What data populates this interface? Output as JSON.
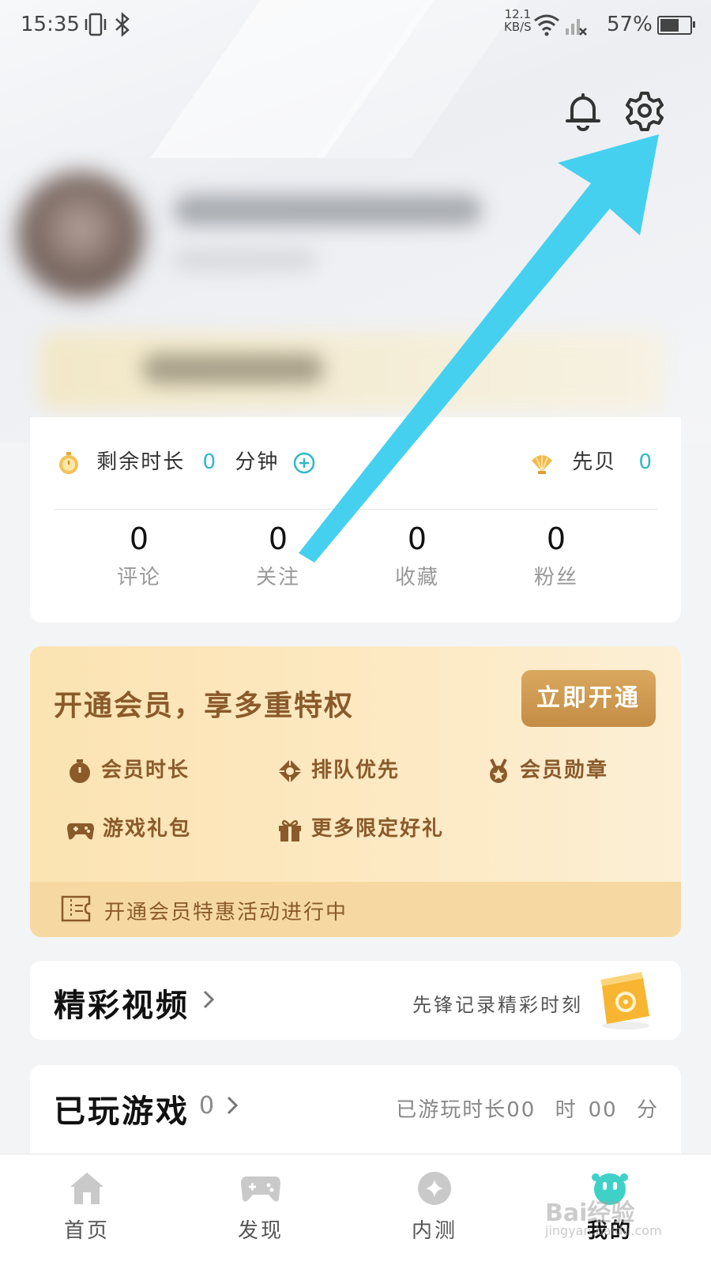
{
  "status_bar": {
    "time": "15:35",
    "speed_value": "12.1",
    "speed_unit": "KB/S",
    "battery": "57%"
  },
  "stats": {
    "remaining_label": "剩余时长",
    "remaining_value": "0",
    "remaining_unit": "分钟",
    "shell_label": "先贝",
    "shell_value": "0",
    "items": [
      {
        "value": "0",
        "label": "评论"
      },
      {
        "value": "0",
        "label": "关注"
      },
      {
        "value": "0",
        "label": "收藏"
      },
      {
        "value": "0",
        "label": "粉丝"
      }
    ]
  },
  "vip": {
    "title": "开通会员，享多重特权",
    "button": "立即开通",
    "perks": [
      {
        "icon": "stopwatch-icon",
        "label": "会员时长"
      },
      {
        "icon": "priority-diamond-icon",
        "label": "排队优先"
      },
      {
        "icon": "medal-icon",
        "label": "会员勋章"
      },
      {
        "icon": "gamepad-icon",
        "label": "游戏礼包"
      },
      {
        "icon": "gift-icon",
        "label": "更多限定好礼"
      }
    ],
    "footer": "开通会员特惠活动进行中"
  },
  "videos": {
    "title": "精彩视频",
    "subtitle": "先锋记录精彩时刻"
  },
  "played": {
    "title": "已玩游戏",
    "count": "0",
    "time_label": "已游玩时长",
    "hours": "00",
    "hours_unit": "时",
    "minutes": "00",
    "minutes_unit": "分"
  },
  "nav": [
    {
      "label": "首页",
      "icon": "home-icon"
    },
    {
      "label": "发现",
      "icon": "gamepad-icon"
    },
    {
      "label": "内测",
      "icon": "beta-star-icon"
    },
    {
      "label": "我的",
      "icon": "mine-mascot-icon"
    }
  ],
  "watermark": {
    "brand": "Bai经验",
    "url": "jingyan.baidu.com"
  },
  "colors": {
    "accent": "#2fb8c8",
    "vip_text": "#8a5a2b",
    "arrow": "#46d0f0"
  }
}
